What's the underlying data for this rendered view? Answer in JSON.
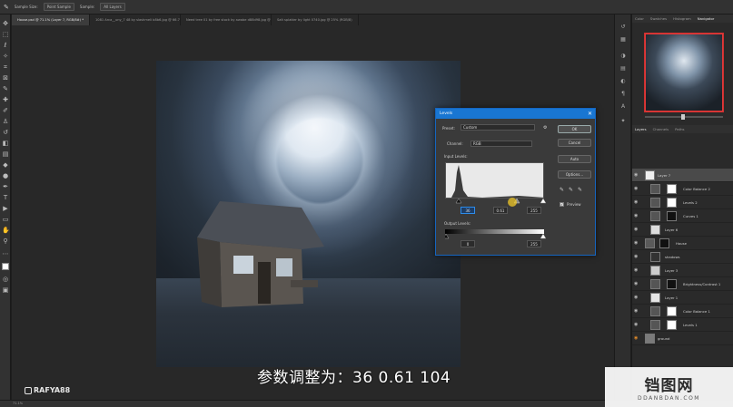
{
  "options_bar": {
    "tool_label": "Sample Size:",
    "sample_value": "Point Sample",
    "sample_label": "Sample:",
    "sample_layers": "All Layers"
  },
  "tabs": [
    {
      "label": "House.psd @ 71.1% (Layer 7, RGB/8#) *",
      "active": true
    },
    {
      "label": "1081 Arca__uny_7 48 by slashmeli b8b6.jpg @ 66.7% (RGB/8)",
      "active": false
    },
    {
      "label": "Need tree 01 by free stock by awabe d88d98.jpg @ 25% (Layer 1, RGB/8)",
      "active": false
    },
    {
      "label": "Salt splatter by light 0740.jpg @ 25% (RGB/8)",
      "active": false
    }
  ],
  "subtitle": "参数调整为：36 0.61 104",
  "logo": "RAFYA88",
  "status": "71.1%",
  "levels_dialog": {
    "title": "Levels",
    "preset_label": "Preset:",
    "preset_value": "Custom",
    "channel_label": "Channel:",
    "channel_value": "RGB",
    "input_levels_label": "Input Levels:",
    "input_black": "36",
    "input_gamma": "0.61",
    "input_white": "255",
    "output_levels_label": "Output Levels:",
    "output_black": "0",
    "output_white": "255",
    "ok": "OK",
    "cancel": "Cancel",
    "auto": "Auto",
    "options": "Options...",
    "preview_label": "Preview",
    "preview_checked": true
  },
  "panel_tabs": [
    "Color",
    "Swatches",
    "Histogram",
    "Navigator"
  ],
  "layer_tabs": [
    "Layers",
    "Channels",
    "Paths"
  ],
  "layers": [
    {
      "name": "Layer 7",
      "selected": true
    },
    {
      "name": "Color Balance 2"
    },
    {
      "name": "Levels 2"
    },
    {
      "name": "Curves 1"
    },
    {
      "name": "Layer 6"
    },
    {
      "name": "House"
    },
    {
      "name": "shadows"
    },
    {
      "name": "Layer 3"
    },
    {
      "name": "Brightness/Contrast 1"
    },
    {
      "name": "Layer 1"
    },
    {
      "name": "Color Balance 1"
    },
    {
      "name": "Levels 1"
    },
    {
      "name": "ground"
    }
  ],
  "watermark": {
    "big": "铛图网",
    "small": "DDANBDAN.COM"
  },
  "colors": {
    "accent": "#1976d2",
    "nav_box": "#e03a3a"
  }
}
